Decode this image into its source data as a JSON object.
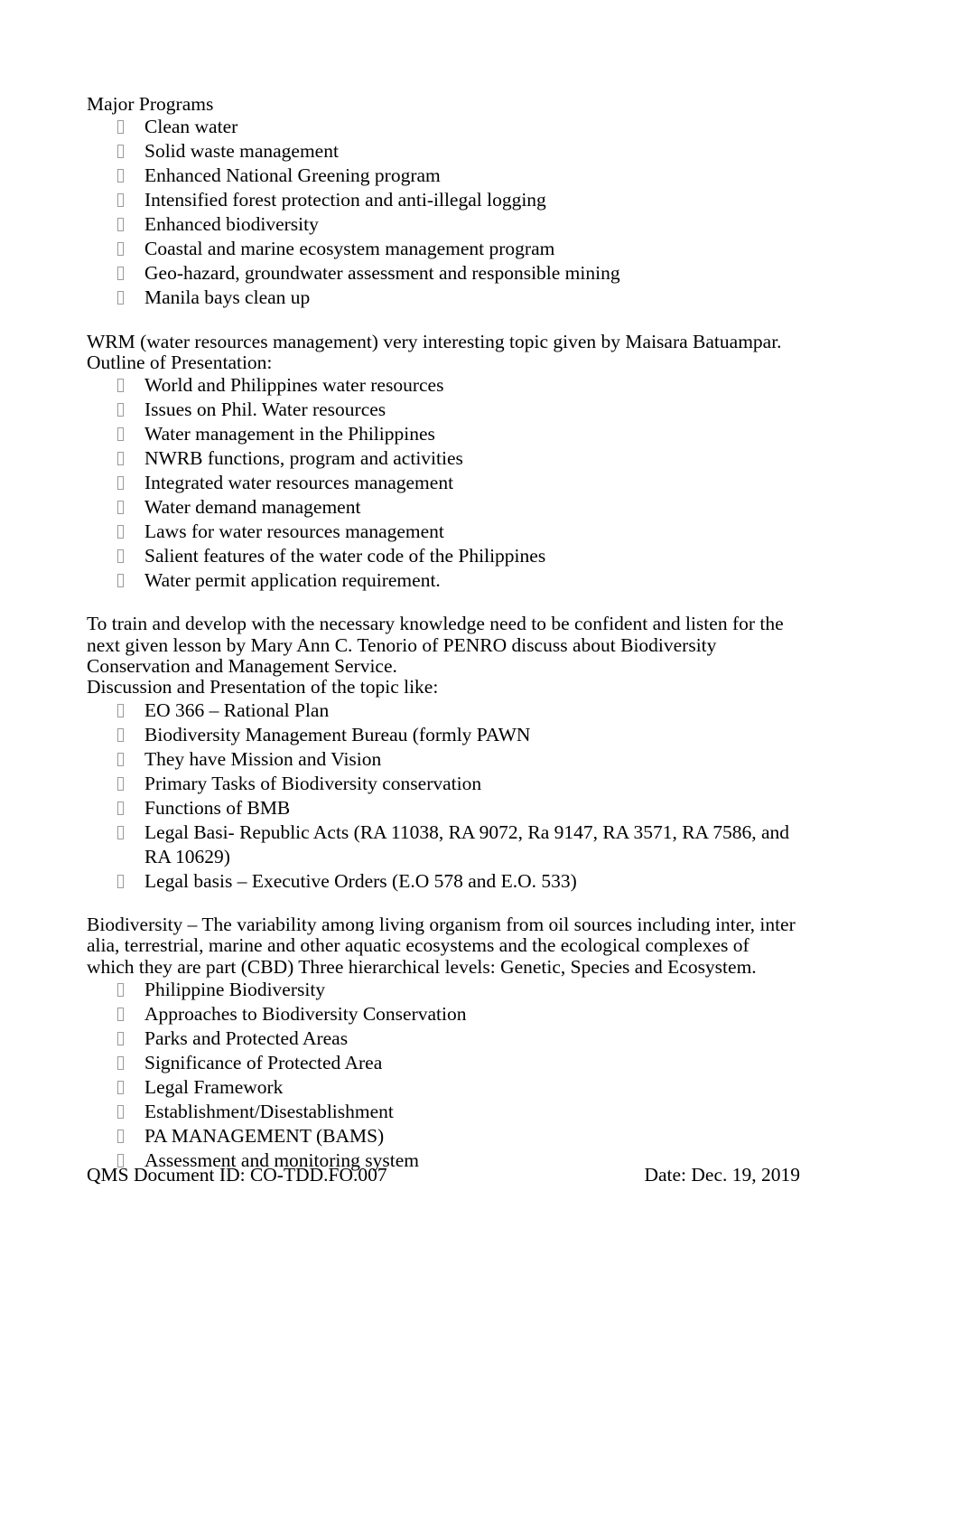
{
  "document": {
    "sections": [
      {
        "heading": "Major Programs",
        "bullets": [
          "Clean water",
          "Solid waste management",
          "Enhanced National Greening program",
          "Intensified forest protection and anti-illegal logging",
          "Enhanced biodiversity",
          "Coastal and marine ecosystem management program",
          "Geo-hazard, groundwater assessment and responsible mining",
          "Manila bays clean up"
        ]
      },
      {
        "paragraph": "WRM (water resources management) very interesting topic given by Maisara Batuampar.",
        "heading": "Outline of Presentation:",
        "bullets": [
          "World and Philippines water resources",
          "Issues on Phil. Water resources",
          "Water management in the Philippines",
          "NWRB functions, program and activities",
          "Integrated water resources management",
          "Water demand management",
          "Laws for water resources management",
          "Salient features of the water code of the Philippines",
          "Water permit application requirement."
        ]
      },
      {
        "paragraph": "To train and develop with the necessary knowledge need to be confident and listen for the next given lesson by Mary Ann C. Tenorio of PENRO discuss about Biodiversity Conservation and Management Service.",
        "heading": "Discussion and Presentation of the topic like:",
        "bullets": [
          "EO 366 – Rational Plan",
          "Biodiversity Management Bureau (formly PAWN",
          "They have Mission and Vision",
          "Primary Tasks of Biodiversity conservation",
          "Functions of BMB",
          "Legal Basi- Republic Acts (RA 11038, RA 9072, Ra 9147, RA 3571, RA 7586, and RA 10629)",
          "Legal basis – Executive Orders (E.O 578 and E.O. 533)"
        ]
      },
      {
        "paragraph": "Biodiversity – The variability among living organism from oil sources including inter, inter alia, terrestrial, marine and other aquatic ecosystems and the ecological complexes of which they are part (CBD) Three hierarchical levels: Genetic, Species and Ecosystem.",
        "bullets": [
          "Philippine Biodiversity",
          "Approaches to Biodiversity Conservation",
          "Parks and Protected Areas",
          "Significance of Protected Area",
          "Legal Framework",
          "Establishment/Disestablishment",
          "PA MANAGEMENT (BAMS)",
          "Assessment and monitoring system"
        ]
      }
    ]
  },
  "footer": {
    "document_id": "QMS Document ID: CO-TDD.FO.007",
    "date": "Date: Dec. 19, 2019"
  },
  "bullet_glyph": "missing-glyph-box"
}
